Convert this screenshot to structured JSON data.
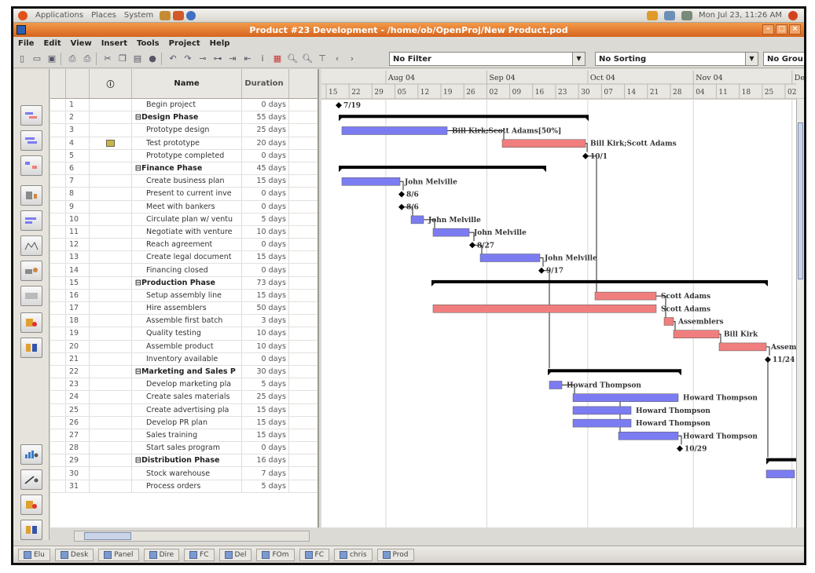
{
  "panel": {
    "menus": [
      "Applications",
      "Places",
      "System"
    ],
    "clock": "Mon Jul 23, 11:26 AM"
  },
  "window": {
    "title": "Product #23 Development - /home/ob/OpenProj/New Product.pod"
  },
  "menubar": [
    "File",
    "Edit",
    "View",
    "Insert",
    "Tools",
    "Project",
    "Help"
  ],
  "toolbar": {
    "filter": "No Filter",
    "sorting": "No Sorting",
    "grouping": "No Grou"
  },
  "table": {
    "headers": {
      "info": "ⓘ",
      "name": "Name",
      "duration": "Duration"
    },
    "rows": [
      {
        "id": "1",
        "name": "Begin project",
        "duration": "0 days",
        "summary": false
      },
      {
        "id": "2",
        "name": "⊟Design Phase",
        "duration": "55 days",
        "summary": true
      },
      {
        "id": "3",
        "name": "Prototype design",
        "duration": "25 days",
        "summary": false
      },
      {
        "id": "4",
        "name": "Test prototype",
        "duration": "20 days",
        "summary": false,
        "note": true
      },
      {
        "id": "5",
        "name": "Prototype completed",
        "duration": "0 days",
        "summary": false
      },
      {
        "id": "6",
        "name": "⊟Finance Phase",
        "duration": "45 days",
        "summary": true
      },
      {
        "id": "7",
        "name": "Create business plan",
        "duration": "15 days",
        "summary": false
      },
      {
        "id": "8",
        "name": "Present to current inve",
        "duration": "0 days",
        "summary": false
      },
      {
        "id": "9",
        "name": "Meet with bankers",
        "duration": "0 days",
        "summary": false
      },
      {
        "id": "10",
        "name": "Circulate plan w/ ventu",
        "duration": "5 days",
        "summary": false
      },
      {
        "id": "11",
        "name": "Negotiate with venture",
        "duration": "10 days",
        "summary": false
      },
      {
        "id": "12",
        "name": "Reach agreement",
        "duration": "0 days",
        "summary": false
      },
      {
        "id": "13",
        "name": "Create legal document",
        "duration": "15 days",
        "summary": false
      },
      {
        "id": "14",
        "name": "Financing closed",
        "duration": "0 days",
        "summary": false
      },
      {
        "id": "15",
        "name": "⊟Production Phase",
        "duration": "73 days",
        "summary": true
      },
      {
        "id": "16",
        "name": "Setup assembly line",
        "duration": "15 days",
        "summary": false
      },
      {
        "id": "17",
        "name": "Hire assemblers",
        "duration": "50 days",
        "summary": false
      },
      {
        "id": "18",
        "name": "Assemble first batch",
        "duration": "3 days",
        "summary": false
      },
      {
        "id": "19",
        "name": "Quality testing",
        "duration": "10 days",
        "summary": false
      },
      {
        "id": "20",
        "name": "Assemble product",
        "duration": "10 days",
        "summary": false
      },
      {
        "id": "21",
        "name": "Inventory available",
        "duration": "0 days",
        "summary": false
      },
      {
        "id": "22",
        "name": "⊟Marketing and Sales P",
        "duration": "30 days",
        "summary": true
      },
      {
        "id": "23",
        "name": "Develop marketing pla",
        "duration": "5 days",
        "summary": false
      },
      {
        "id": "24",
        "name": "Create sales materials",
        "duration": "25 days",
        "summary": false
      },
      {
        "id": "25",
        "name": "Create advertising pla",
        "duration": "15 days",
        "summary": false
      },
      {
        "id": "26",
        "name": "Develop PR plan",
        "duration": "15 days",
        "summary": false
      },
      {
        "id": "27",
        "name": "Sales training",
        "duration": "15 days",
        "summary": false
      },
      {
        "id": "28",
        "name": "Start sales program",
        "duration": "0 days",
        "summary": false
      },
      {
        "id": "29",
        "name": "⊟Distribution Phase",
        "duration": "16 days",
        "summary": true
      },
      {
        "id": "30",
        "name": "Stock warehouse",
        "duration": "7 days",
        "summary": false
      },
      {
        "id": "31",
        "name": "Process orders",
        "duration": "5 days",
        "summary": false
      }
    ]
  },
  "timeline": {
    "months": [
      "Aug 04",
      "Sep 04",
      "Oct 04",
      "Nov 04",
      "Dec"
    ],
    "weeks": [
      "15",
      "22",
      "29",
      "05",
      "12",
      "19",
      "26",
      "02",
      "09",
      "16",
      "23",
      "30",
      "07",
      "14",
      "21",
      "28",
      "04",
      "11",
      "18",
      "25",
      "02"
    ]
  },
  "gantt": {
    "bars": [
      {
        "row": 1,
        "type": "milestone",
        "label": "7/19"
      },
      {
        "row": 2,
        "type": "summary"
      },
      {
        "row": 3,
        "type": "normal",
        "label": "Bill Kirk;Scott Adams[50%]"
      },
      {
        "row": 4,
        "type": "critical",
        "label": "Bill Kirk;Scott Adams"
      },
      {
        "row": 5,
        "type": "milestone",
        "label": "10/1"
      },
      {
        "row": 6,
        "type": "summary"
      },
      {
        "row": 7,
        "type": "normal",
        "label": "John Melville"
      },
      {
        "row": 8,
        "type": "milestone",
        "label": "8/6"
      },
      {
        "row": 9,
        "type": "milestone",
        "label": "8/6"
      },
      {
        "row": 10,
        "type": "normal",
        "label": "John Melville"
      },
      {
        "row": 11,
        "type": "normal",
        "label": "John Melville"
      },
      {
        "row": 12,
        "type": "milestone",
        "label": "8/27"
      },
      {
        "row": 13,
        "type": "normal",
        "label": "John Melville"
      },
      {
        "row": 14,
        "type": "milestone",
        "label": "9/17"
      },
      {
        "row": 15,
        "type": "summary"
      },
      {
        "row": 16,
        "type": "critical",
        "label": "Scott Adams"
      },
      {
        "row": 17,
        "type": "critical",
        "label": "Scott Adams"
      },
      {
        "row": 18,
        "type": "critical",
        "label": "Assemblers"
      },
      {
        "row": 19,
        "type": "critical",
        "label": "Bill Kirk"
      },
      {
        "row": 20,
        "type": "critical",
        "label": "Assem"
      },
      {
        "row": 21,
        "type": "milestone",
        "label": "11/24"
      },
      {
        "row": 22,
        "type": "summary"
      },
      {
        "row": 23,
        "type": "normal",
        "label": "Howard Thompson"
      },
      {
        "row": 24,
        "type": "normal",
        "label": "Howard Thompson"
      },
      {
        "row": 25,
        "type": "normal",
        "label": "Howard Thompson"
      },
      {
        "row": 26,
        "type": "normal",
        "label": "Howard Thompson"
      },
      {
        "row": 27,
        "type": "normal",
        "label": "Howard Thompson"
      },
      {
        "row": 28,
        "type": "milestone",
        "label": "10/29"
      },
      {
        "row": 29,
        "type": "summary"
      },
      {
        "row": 30,
        "type": "normal"
      },
      {
        "row": 31,
        "type": "normal"
      }
    ]
  },
  "taskbar": [
    "Elu",
    "Desk",
    "Panel",
    "Dire",
    "FC",
    "Del",
    "FOm",
    "FC",
    "chris",
    "Prod"
  ],
  "colors": {
    "normal_bar": "#7c7cf2",
    "critical_bar": "#f07e7e",
    "summary_bar": "#000000",
    "titlebar": "#e0782c"
  }
}
